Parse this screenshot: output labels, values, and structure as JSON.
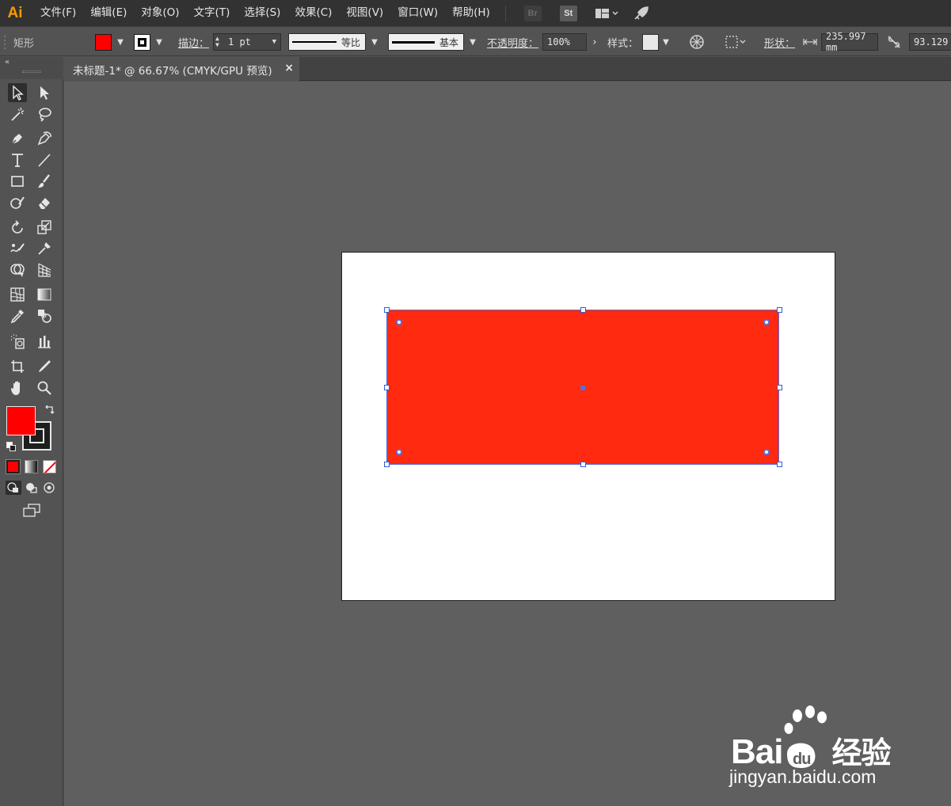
{
  "app": {
    "logo": "Ai"
  },
  "menu": [
    {
      "label": "文件(F)"
    },
    {
      "label": "编辑(E)"
    },
    {
      "label": "对象(O)"
    },
    {
      "label": "文字(T)"
    },
    {
      "label": "选择(S)"
    },
    {
      "label": "效果(C)"
    },
    {
      "label": "视图(V)"
    },
    {
      "label": "窗口(W)"
    },
    {
      "label": "帮助(H)"
    }
  ],
  "menu_icons": {
    "bridge": "Br",
    "stock": "St"
  },
  "control": {
    "object_type": "矩形",
    "fill_color": "#ff0000",
    "stroke_label": "描边：",
    "stroke_weight": "1 pt",
    "profile_label": "等比",
    "brush_label": "基本",
    "opacity_label": "不透明度：",
    "opacity_value": "100%",
    "style_label": "样式：",
    "shape_label": "形状：",
    "width_value": "235.997 mm",
    "height_value": "93.129"
  },
  "document": {
    "tab_title": "未标题-1* @ 66.67% (CMYK/GPU 预览)",
    "close_glyph": "×"
  },
  "colors": {
    "rect_fill": "#ff2a10",
    "selection": "#5a6fd8",
    "accent": "#ff9a00"
  },
  "watermark": {
    "brand": "Bai",
    "brand_suffix": "经验",
    "url": "jingyan.baidu.com"
  }
}
